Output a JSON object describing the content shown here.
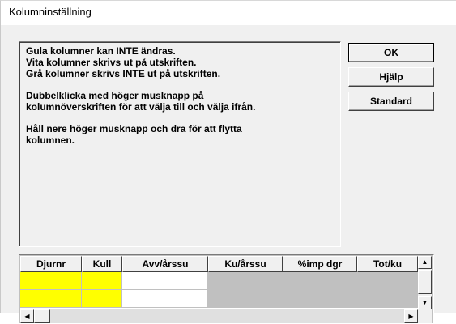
{
  "window": {
    "title": "Kolumninställning"
  },
  "info": {
    "line1": "Gula kolumner kan INTE ändras.",
    "line2": "Vita kolumner skrivs ut på utskriften.",
    "line3": "Grå kolumner skrivs INTE ut på utskriften.",
    "paragraph2": "Dubbelklicka med höger musknapp på kolumnöverskriften för att välja till och välja ifrån.",
    "paragraph3": "Håll nere höger musknapp och dra för att flytta kolumnen."
  },
  "buttons": {
    "ok": "OK",
    "help": "Hjälp",
    "standard": "Standard"
  },
  "grid": {
    "columns": [
      "Djurnr",
      "Kull",
      "Avv/årssu",
      "Ku/årssu",
      "%imp dgr",
      "Tot/ku"
    ],
    "column_colors": [
      "yellow",
      "yellow",
      "white",
      "gray",
      "gray",
      "gray"
    ],
    "scroll_up_glyph": "▲",
    "scroll_down_glyph": "▼",
    "scroll_left_glyph": "◀",
    "scroll_right_glyph": "▶"
  },
  "colors": {
    "yellow_column": "#ffff00",
    "white_column": "#ffffff",
    "gray_column": "#c0c0c0"
  }
}
